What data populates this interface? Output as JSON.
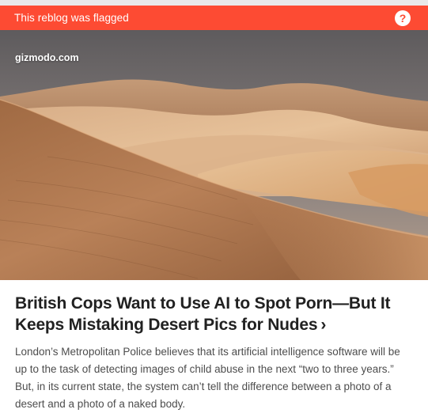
{
  "banner": {
    "text": "This reblog was flagged",
    "help_glyph": "?",
    "color": "#fd4b33"
  },
  "post": {
    "source": "gizmodo.com",
    "title": "British Cops Want to Use AI to Spot Porn—But It Keeps Mistaking Desert Pics for Nudes",
    "chevron": "›",
    "excerpt": "London’s Metropolitan Police believes that its artificial intelligence software will be up to the task of detecting images of child abuse in the next “two to three years.” But, in its current state, the system can’t tell the difference between a photo of a desert and a photo of a naked body."
  },
  "icons": {
    "help": "question-mark-icon",
    "chevron": "chevron-right-icon"
  }
}
